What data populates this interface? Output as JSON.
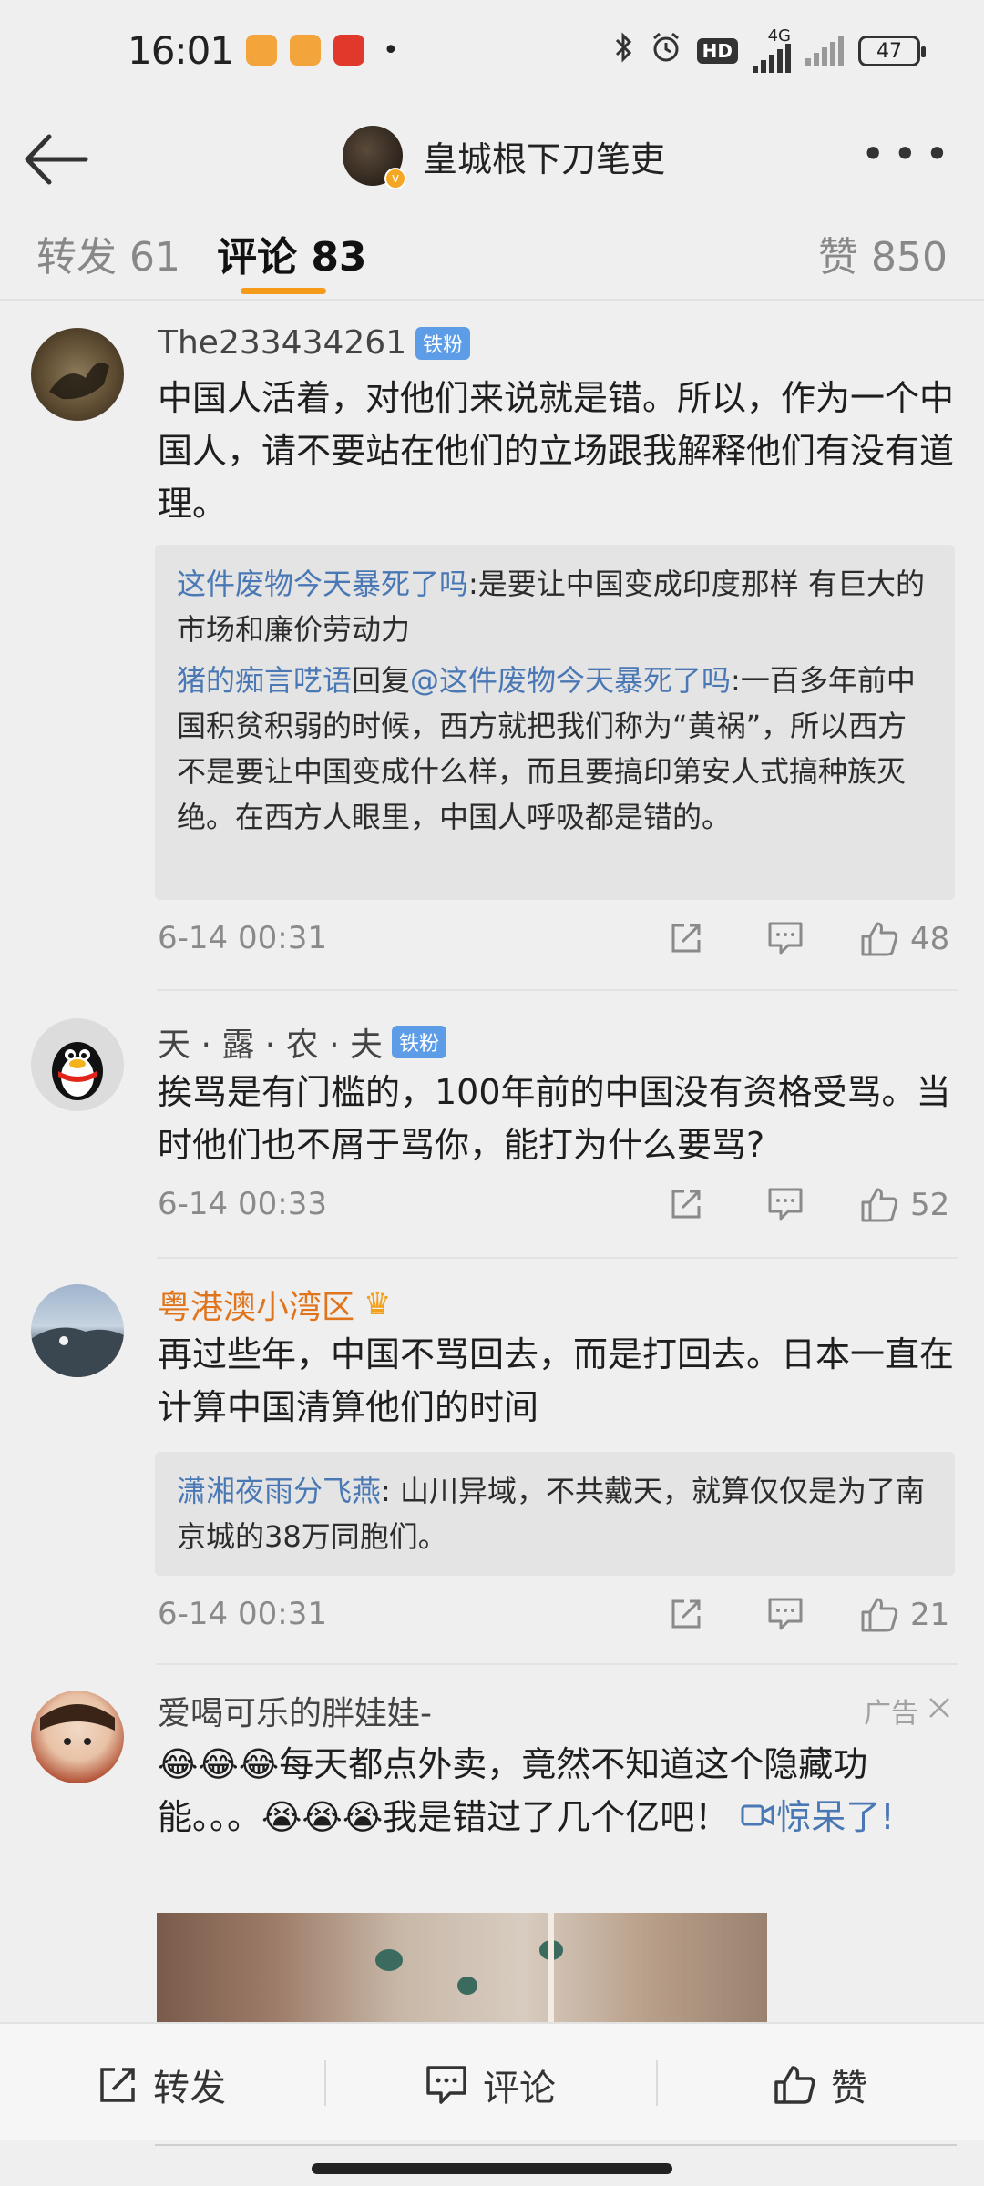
{
  "status_bar": {
    "time": "16:01",
    "network": "4G",
    "hd": "HD",
    "battery": "47"
  },
  "header": {
    "title": "皇城根下刀笔吏"
  },
  "tabs": {
    "repost": "转发 61",
    "comment": "评论 83",
    "like": "赞 850"
  },
  "comments": [
    {
      "name": "The233434261",
      "badge": "铁粉",
      "text": "中国人活着，对他们来说就是错。所以，作为一个中国人，请不要站在他们的立场跟我解释他们有没有道理。",
      "quote": [
        {
          "user": "这件废物今天暴死了吗",
          "sep": ":",
          "text": "是要让中国变成印度那样  有巨大的市场和廉价劳动力"
        },
        {
          "user": "猪的痴言呓语",
          "mid": "回复",
          "target": "@这件废物今天暴死了吗",
          "sep": ":",
          "text": "一百多年前中国积贫积弱的时候，西方就把我们称为“黄祸”，所以西方不是要让中国变成什么样，而且要搞印第安人式搞种族灭绝。在西方人眼里，中国人呼吸都是错的。"
        }
      ],
      "time": "6-14 00:31",
      "likes": "48"
    },
    {
      "name": "天 · 露 · 农 · 夫",
      "badge": "铁粉",
      "text": "挨骂是有门槛的，100年前的中国没有资格受骂。当时他们也不屑于骂你，能打为什么要骂?",
      "time": "6-14 00:33",
      "likes": "52"
    },
    {
      "name": "粤港澳小湾区",
      "text": "再过些年，中国不骂回去，而是打回去。日本一直在计算中国清算他们的时间",
      "quote": [
        {
          "user": "潇湘夜雨分飞燕",
          "sep": ":",
          "text": " 山川异域，不共戴天，就算仅仅是为了南京城的38万同胞们。"
        }
      ],
      "time": "6-14 00:31",
      "likes": "21"
    }
  ],
  "ad": {
    "name": "爱喝可乐的胖娃娃-",
    "label": "广告",
    "emoji_prefix": "😂😂😂",
    "text_a": "每天都点外卖，竟然不知道这个隐藏功能。。。",
    "emoji_mid": "😭😭😭",
    "text_b": "我是错过了几个亿吧！",
    "link_a": "惊呆",
    "link_b": "了!"
  },
  "bottom_bar": {
    "repost": "转发",
    "comment": "评论",
    "like": "赞"
  },
  "colors": {
    "accent_orange": "#f59b1a",
    "link_blue": "#4a78b5",
    "badge_blue": "#5d9de8",
    "vip_orange": "#e0741c"
  }
}
